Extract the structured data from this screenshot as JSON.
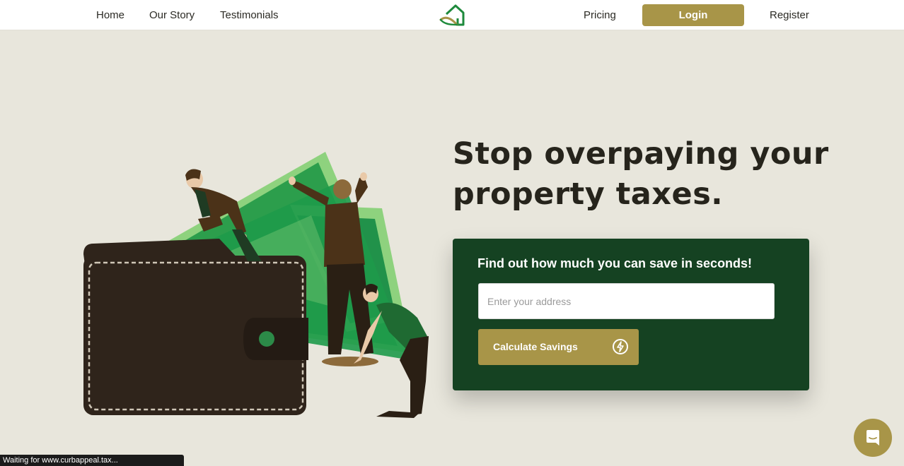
{
  "nav": {
    "home": "Home",
    "our_story": "Our Story",
    "testimonials": "Testimonials",
    "pricing": "Pricing",
    "login": "Login",
    "register": "Register",
    "logo_icon": "house-logo-icon"
  },
  "hero": {
    "headline_line1": "Stop overpaying your",
    "headline_line2": "property taxes."
  },
  "card": {
    "title": "Find out how much you can save in seconds!",
    "address_placeholder": "Enter your address",
    "address_value": "",
    "button_label": "Calculate Savings",
    "button_icon": "lightning-bolt-icon"
  },
  "chat": {
    "icon": "chat-bubble-icon"
  },
  "status_bar": {
    "text": "Waiting for www.curbappeal.tax..."
  },
  "colors": {
    "background": "#E8E6DC",
    "brand_gold": "#A89548",
    "card_green": "#154222",
    "headline_text": "#26241C",
    "money_green": "#1E9A4A"
  }
}
